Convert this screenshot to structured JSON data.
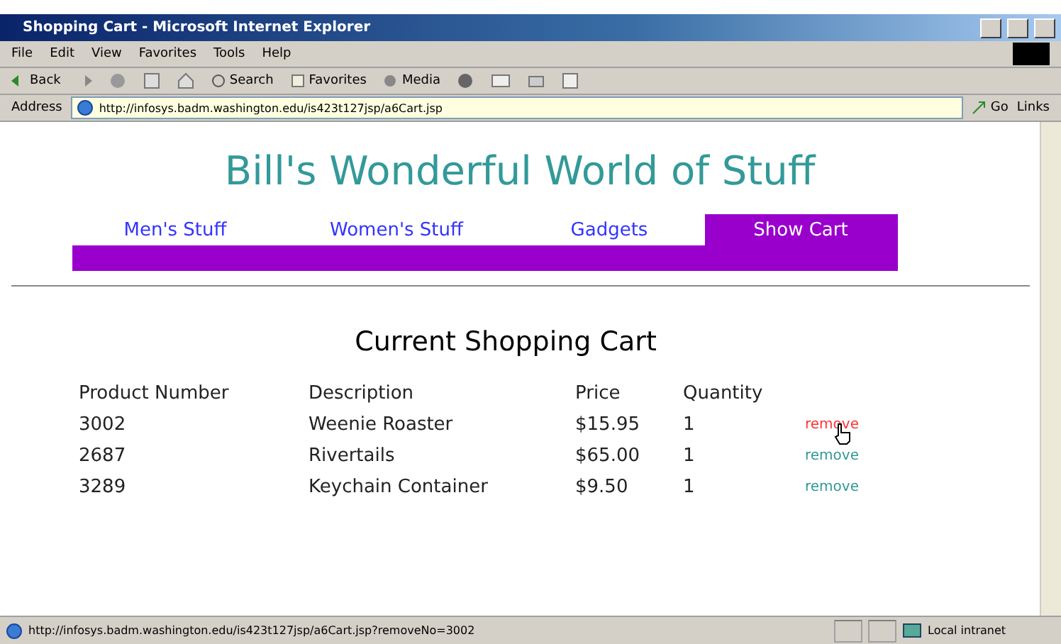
{
  "window": {
    "title": "Shopping Cart - Microsoft Internet Explorer"
  },
  "menu": [
    "File",
    "Edit",
    "View",
    "Favorites",
    "Tools",
    "Help"
  ],
  "toolbar": {
    "back": "Back",
    "search": "Search",
    "favorites": "Favorites",
    "media": "Media"
  },
  "address": {
    "label": "Address",
    "value": "http://infosys.badm.washington.edu/is423t127jsp/a6Cart.jsp",
    "go": "Go",
    "links": "Links"
  },
  "page": {
    "heading": "Bill's Wonderful World of Stuff",
    "tabs": [
      {
        "label": "Men's Stuff",
        "selected": false
      },
      {
        "label": "Women's Stuff",
        "selected": false
      },
      {
        "label": "Gadgets",
        "selected": false
      },
      {
        "label": "Show Cart",
        "selected": true
      }
    ],
    "cart_title": "Current Shopping Cart",
    "columns": [
      "Product Number",
      "Description",
      "Price",
      "Quantity"
    ],
    "rows": [
      {
        "number": "3002",
        "description": "Weenie Roaster",
        "price": "$15.95",
        "quantity": "1",
        "action": "remove",
        "hovered": true
      },
      {
        "number": "2687",
        "description": "Rivertails",
        "price": "$65.00",
        "quantity": "1",
        "action": "remove",
        "hovered": false
      },
      {
        "number": "3289",
        "description": "Keychain Container",
        "price": "$9.50",
        "quantity": "1",
        "action": "remove",
        "hovered": false
      }
    ]
  },
  "status_bar": {
    "url": "http://infosys.badm.washington.edu/is423t127jsp/a6Cart.jsp?removeNo=3002",
    "zone": "Local intranet"
  }
}
